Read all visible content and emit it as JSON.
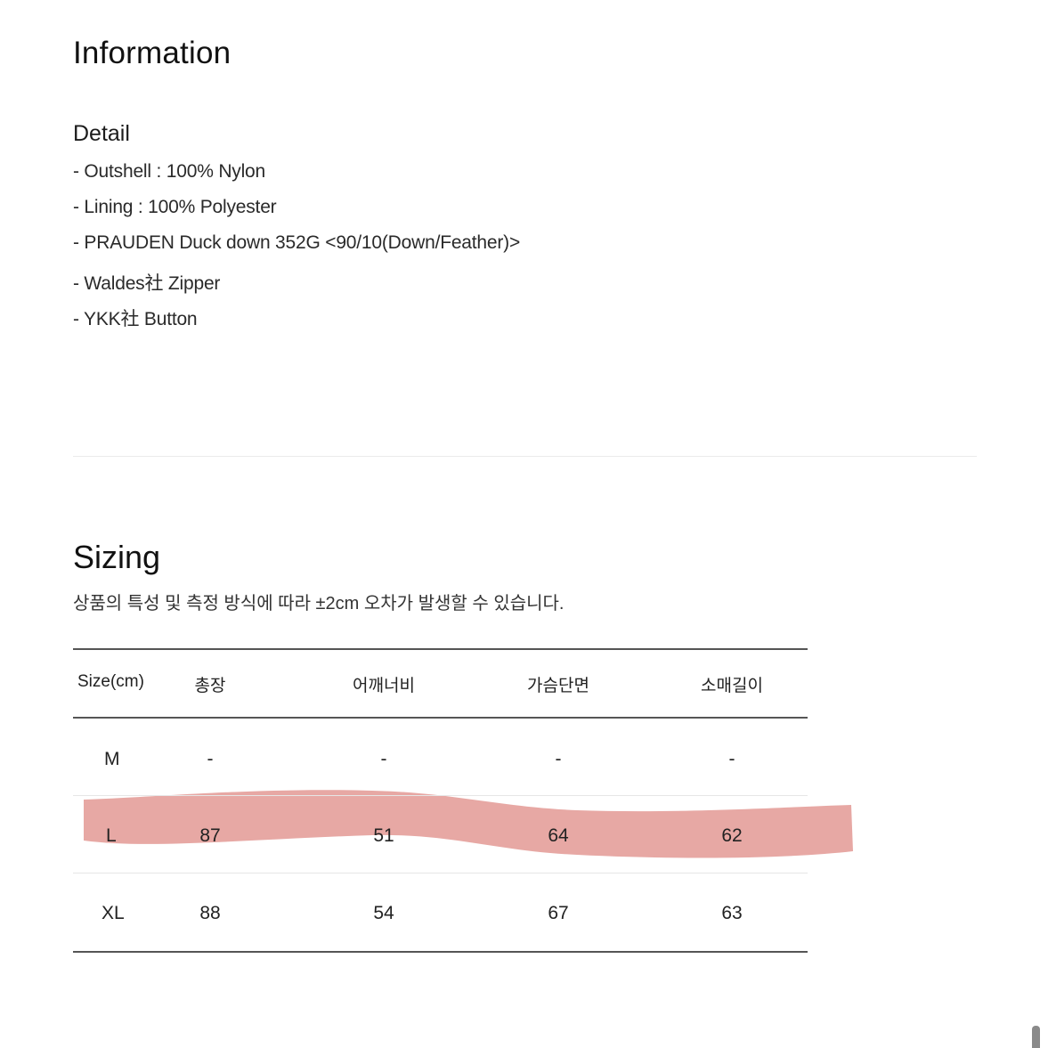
{
  "information": {
    "title": "Information",
    "detail_title": "Detail",
    "detail_lines": [
      "- Outshell : 100% Nylon",
      "- Lining : 100% Polyester",
      "- PRAUDEN Duck down 352G <90/10(Down/Feather)>",
      "- Waldes社 Zipper",
      "- YKK社 Button"
    ]
  },
  "sizing": {
    "title": "Sizing",
    "note": "상품의 특성 및 측정 방식에 따라 ±2cm 오차가 발생할 수 있습니다.",
    "columns": [
      "Size(cm)",
      "총장",
      "어깨너비",
      "가슴단면",
      "소매길이"
    ],
    "rows": [
      {
        "size": "M",
        "values": [
          "-",
          "-",
          "-",
          "-"
        ]
      },
      {
        "size": "L",
        "values": [
          "87",
          "51",
          "64",
          "62"
        ],
        "highlighted": true
      },
      {
        "size": "XL",
        "values": [
          "88",
          "54",
          "67",
          "63"
        ]
      }
    ],
    "highlight_color": "#e49e9a"
  },
  "scrollbar": {
    "icon": "scrollbar-thumb"
  }
}
